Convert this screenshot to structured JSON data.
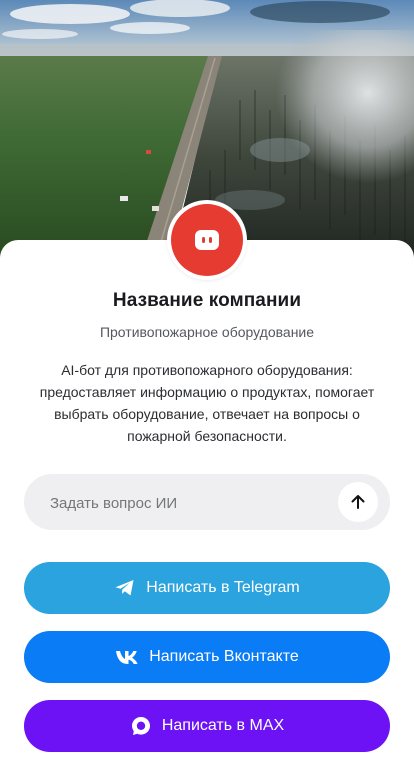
{
  "company": {
    "name": "Название компании",
    "category": "Противопожарное оборудование",
    "description": "AI-бот для противопожарного оборудования: предоставляет информацию о продуктах, помогает выбрать оборудование, отвечает на вопросы о пожарной безопасности."
  },
  "ask": {
    "placeholder": "Задать вопрос ИИ"
  },
  "buttons": {
    "telegram": "Написать в Telegram",
    "vk": "Написать Вконтакте",
    "max": "Написать в MAX"
  },
  "colors": {
    "avatar_bg": "#e53b30",
    "telegram": "#2aa3df",
    "vk": "#0a7cf5",
    "max": "#6c12f4"
  },
  "icons": {
    "avatar": "chat-bot-icon",
    "send": "arrow-up-icon",
    "telegram": "telegram-icon",
    "vk": "vk-icon",
    "max": "max-icon"
  }
}
